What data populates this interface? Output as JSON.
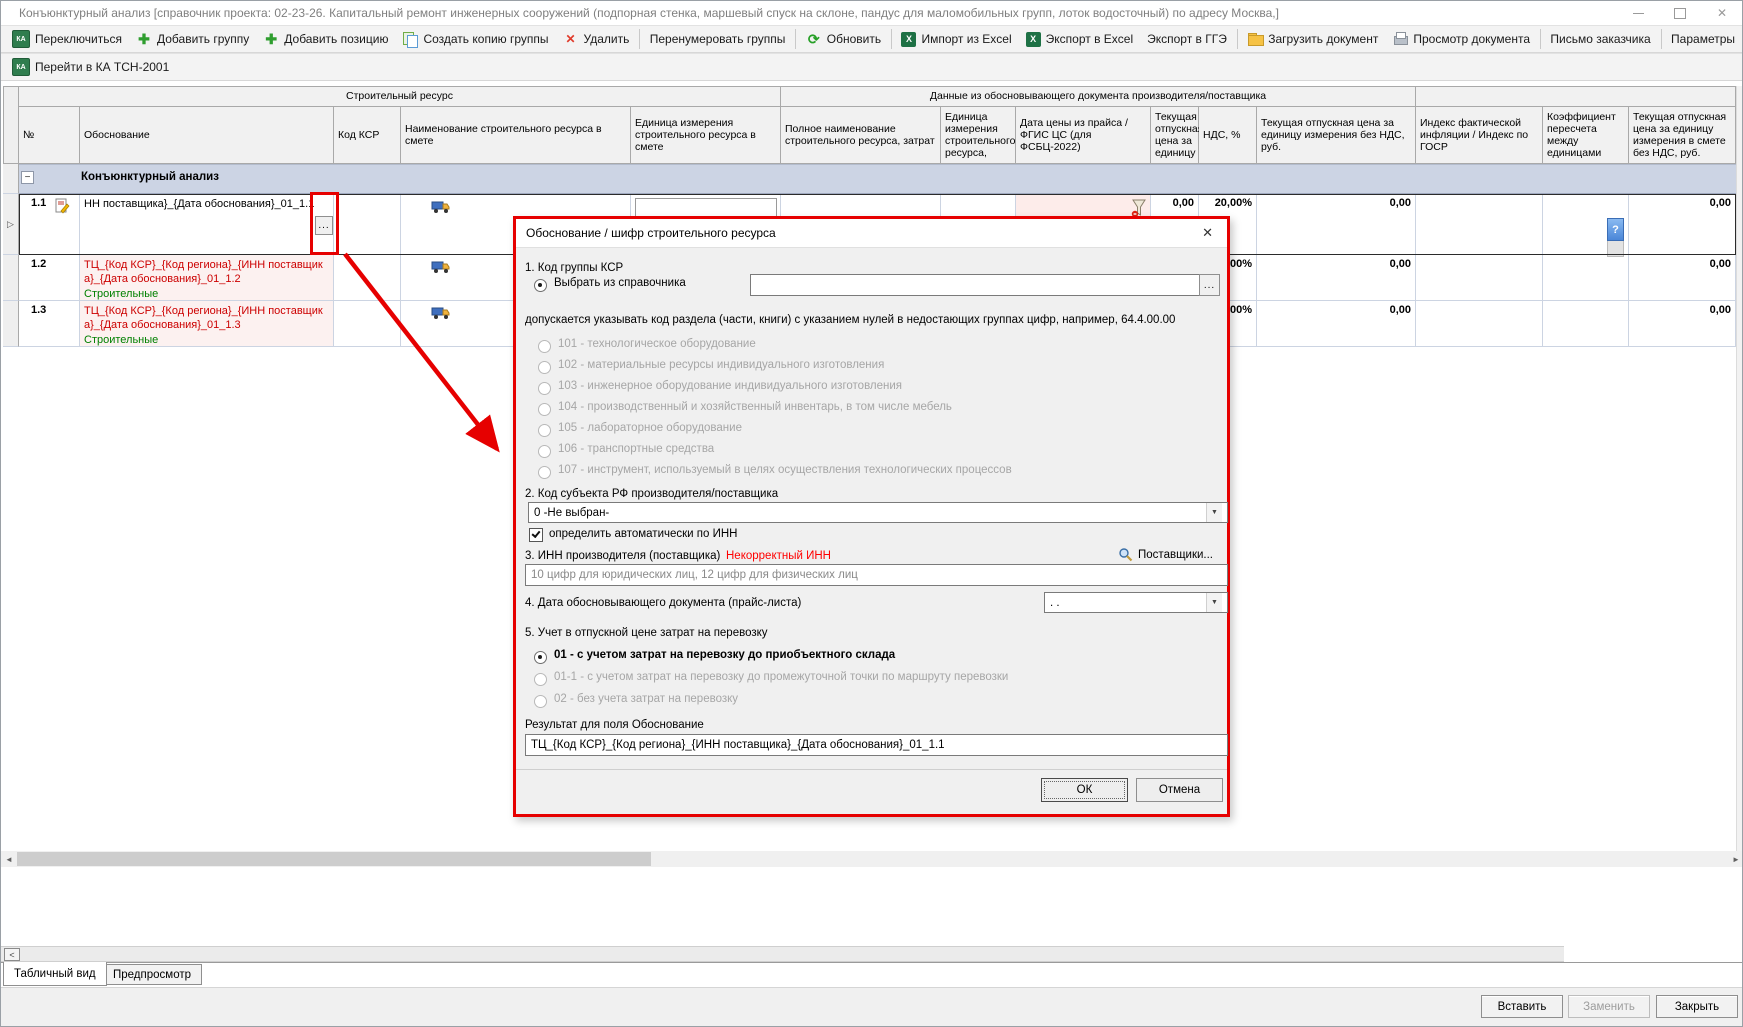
{
  "window": {
    "title": "Конъюнктурный анализ [справочник проекта: 02-23-26. Капитальный ремонт инженерных сооружений (подпорная стенка, маршевый спуск на склоне, пандус для маломобильных групп, лоток водосточный) по адресу Москва,]"
  },
  "icons": {
    "ka": "КА",
    "excel_x": "X",
    "question": "?",
    "minus": "−",
    "row_marker": "▷",
    "ellipsis": "...",
    "dropdown": "▼",
    "close_x": "✕",
    "left_arrow": "◄",
    "right_arrow": "►",
    "small_left": "<",
    "plus": "✚",
    "delete_x": "✕",
    "refresh": "⟳"
  },
  "toolbar": {
    "switch": "Переключиться",
    "add_group": "Добавить группу",
    "add_item": "Добавить позицию",
    "copy_group": "Создать копию группы",
    "delete": "Удалить",
    "renumber": "Перенумеровать группы",
    "refresh": "Обновить",
    "import_excel": "Импорт из Excel",
    "export_excel": "Экспорт в Excel",
    "export_gge": "Экспорт в ГГЭ",
    "load_doc": "Загрузить документ",
    "view_doc": "Просмотр документа",
    "customer_letter": "Письмо заказчика",
    "params": "Параметры"
  },
  "toolbar2": {
    "goto_ka": "Перейти в КА ТСН-2001"
  },
  "grid": {
    "groups": {
      "resource": "Строительный ресурс",
      "supplier_data": "Данные из обосновывающего документа производителя/поставщика"
    },
    "cols": {
      "num": "№",
      "justification": "Обоснование",
      "ksr": "Код КСР",
      "name": "Наименование строительного ресурса в смете",
      "unit": "Единица измерения строительного ресурса в смете",
      "full_name": "Полное наименование строительного ресурса, затрат",
      "unit2": "Единица измерения строительного ресурса,",
      "price_date": "Дата цены из прайса / ФГИС ЦС (для ФСБЦ-2022)",
      "price": "Текущая отпускная цена за единицу",
      "vat": "НДС, %",
      "price_no_vat": "Текущая отпускная цена за единицу измерения без НДС, руб.",
      "inflation": "Индекс фактической инфляции / Индекс по ГОСР",
      "coef": "Коэффициент пересчета между единицами",
      "price_estimate": "Текущая отпускная цена за единицу измерения в смете без НДС, руб."
    },
    "group_row": "Конъюнктурный анализ",
    "rows": [
      {
        "num": "1.1",
        "justification": "НН поставщика}_{Дата обоснования}_01_1.1",
        "price": "0,00",
        "vat": "20,00%",
        "price_no_vat": "0,00",
        "price_estimate": "0,00"
      },
      {
        "num": "1.2",
        "justification": "ТЦ_{Код КСР}_{Код региона}_{ИНН поставщика}_{Дата обоснования}_01_1.2",
        "category": "Строительные",
        "vat": "20,00%",
        "price_no_vat": "0,00",
        "price_estimate": "0,00"
      },
      {
        "num": "1.3",
        "justification": "ТЦ_{Код КСР}_{Код региона}_{ИНН поставщика}_{Дата обоснования}_01_1.3",
        "category": "Строительные",
        "vat": "20,00%",
        "price_no_vat": "0,00",
        "price_estimate": "0,00"
      }
    ]
  },
  "dialog": {
    "title": "Обоснование / шифр строительного ресурса",
    "s1": {
      "label": "1. Код группы КСР",
      "radio_catalog": "Выбрать из справочника",
      "hint": "допускается указывать код раздела (части, книги) с указанием нулей в недостающих группах цифр,  например, 64.4.00.00",
      "options": [
        "101 - технологическое оборудование",
        "102 - материальные ресурсы индивидуального изготовления",
        "103 - инженерное оборудование индивидуального изготовления",
        "104 - производственный и хозяйственный инвентарь, в том числе мебель",
        "105 - лабораторное оборудование",
        "106 - транспортные средства",
        "107 - инструмент, используемый в целях осуществления технологических процессов"
      ]
    },
    "s2": {
      "label": "2. Код субъекта РФ производителя/поставщика",
      "value": "0 -Не выбран-",
      "auto_by_inn": "определить автоматически по ИНН"
    },
    "s3": {
      "label": "3. ИНН производителя (поставщика)",
      "error": "Некорректный ИНН",
      "suppliers": "Поставщики...",
      "placeholder": "10 цифр для юридических лиц, 12 цифр для физических лиц"
    },
    "s4": {
      "label": "4. Дата обосновывающего документа (прайс-листа)",
      "value": "  .  ."
    },
    "s5": {
      "label": "5. Учет в отпускной цене затрат на перевозку",
      "options": [
        "01 - с учетом затрат на перевозку до приобъектного склада",
        "01-1 - с учетом затрат на перевозку до промежуточной точки по маршруту перевозки",
        "02 - без учета затрат на перевозку"
      ]
    },
    "result": {
      "label": "Результат для поля Обоснование",
      "value": "ТЦ_{Код КСР}_{Код региона}_{ИНН поставщика}_{Дата обоснования}_01_1.1"
    },
    "ok": "ОК",
    "cancel": "Отмена"
  },
  "tabs": {
    "table": "Табличный вид",
    "preview": "Предпросмотр"
  },
  "footer": {
    "insert": "Вставить",
    "replace": "Заменить",
    "close": "Закрыть"
  },
  "colors": {
    "annotation": "#e60000",
    "row_text_red": "#cc0000",
    "row_text_green": "#008000",
    "error_red": "#ff0000"
  }
}
